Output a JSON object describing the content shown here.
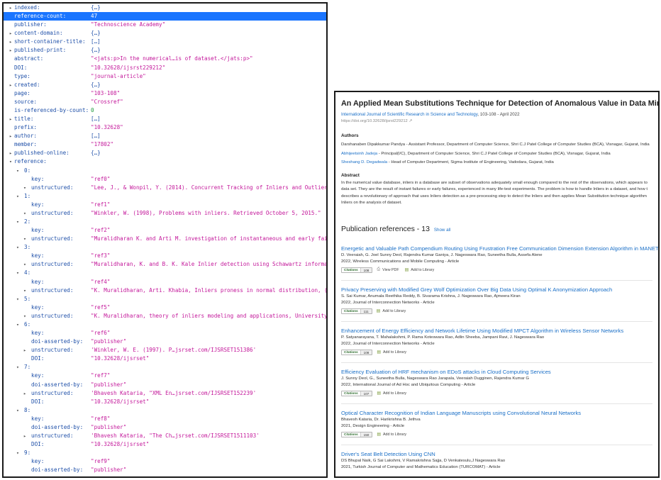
{
  "json_viewer": {
    "rows": [
      {
        "indent": 0,
        "toggle": "▸",
        "key": "indexed:",
        "value": "{…}",
        "vtype": "obj"
      },
      {
        "indent": 0,
        "toggle": "",
        "key": "reference-count:",
        "value": "47",
        "vtype": "num",
        "selected": true
      },
      {
        "indent": 0,
        "toggle": "",
        "key": "publisher:",
        "value": "\"Technoscience Academy\"",
        "vtype": "str"
      },
      {
        "indent": 0,
        "toggle": "▸",
        "key": "content-domain:",
        "value": "{…}",
        "vtype": "obj"
      },
      {
        "indent": 0,
        "toggle": "▸",
        "key": "short-container-title:",
        "value": "[…]",
        "vtype": "obj"
      },
      {
        "indent": 0,
        "toggle": "▸",
        "key": "published-print:",
        "value": "{…}",
        "vtype": "obj"
      },
      {
        "indent": 0,
        "toggle": "",
        "key": "abstract:",
        "value": "\"<jats:p>In the numerical…is of dataset.</jats:p>\"",
        "vtype": "str"
      },
      {
        "indent": 0,
        "toggle": "",
        "key": "DOI:",
        "value": "\"10.32628/ijsrst229212\"",
        "vtype": "str"
      },
      {
        "indent": 0,
        "toggle": "",
        "key": "type:",
        "value": "\"journal-article\"",
        "vtype": "str"
      },
      {
        "indent": 0,
        "toggle": "▸",
        "key": "created:",
        "value": "{…}",
        "vtype": "obj"
      },
      {
        "indent": 0,
        "toggle": "",
        "key": "page:",
        "value": "\"103-108\"",
        "vtype": "str"
      },
      {
        "indent": 0,
        "toggle": "",
        "key": "source:",
        "value": "\"Crossref\"",
        "vtype": "str"
      },
      {
        "indent": 0,
        "toggle": "",
        "key": "is-referenced-by-count:",
        "value": "0",
        "vtype": "num"
      },
      {
        "indent": 0,
        "toggle": "▸",
        "key": "title:",
        "value": "[…]",
        "vtype": "obj"
      },
      {
        "indent": 0,
        "toggle": "",
        "key": "prefix:",
        "value": "\"10.32628\"",
        "vtype": "str"
      },
      {
        "indent": 0,
        "toggle": "▸",
        "key": "author:",
        "value": "[…]",
        "vtype": "obj"
      },
      {
        "indent": 0,
        "toggle": "",
        "key": "member:",
        "value": "\"17802\"",
        "vtype": "str"
      },
      {
        "indent": 0,
        "toggle": "▸",
        "key": "published-online:",
        "value": "{…}",
        "vtype": "obj"
      },
      {
        "indent": 0,
        "toggle": "▾",
        "key": "reference:",
        "value": "",
        "vtype": "obj"
      },
      {
        "indent": 1,
        "toggle": "▾",
        "key": "0:",
        "value": "",
        "vtype": "obj"
      },
      {
        "indent": 2,
        "toggle": "",
        "key": "key:",
        "value": "\"ref0\"",
        "vtype": "str"
      },
      {
        "indent": 2,
        "toggle": "▾",
        "key": "unstructured:",
        "value": "\"Lee, J., & Wonpil, Y. (2014). Concurrent Tracking of Inliers and Outliers.\"",
        "vtype": "str"
      },
      {
        "indent": 1,
        "toggle": "▾",
        "key": "1:",
        "value": "",
        "vtype": "obj"
      },
      {
        "indent": 2,
        "toggle": "",
        "key": "key:",
        "value": "\"ref1\"",
        "vtype": "str"
      },
      {
        "indent": 2,
        "toggle": "▾",
        "key": "unstructured:",
        "value": "\"Winkler, W. (1998), Problems with inliers. Retrieved October 5, 2015.\"",
        "vtype": "str"
      },
      {
        "indent": 1,
        "toggle": "▾",
        "key": "2:",
        "value": "",
        "vtype": "obj"
      },
      {
        "indent": 2,
        "toggle": "",
        "key": "key:",
        "value": "\"ref2\"",
        "vtype": "str"
      },
      {
        "indent": 2,
        "toggle": "▾",
        "key": "unstructured:",
        "value": "\"Muralidharan K. and Arti M. investigation of instantaneous and early failures in I",
        "vtype": "str"
      },
      {
        "indent": 1,
        "toggle": "▾",
        "key": "3:",
        "value": "",
        "vtype": "obj"
      },
      {
        "indent": 2,
        "toggle": "",
        "key": "key:",
        "value": "\"ref3\"",
        "vtype": "str"
      },
      {
        "indent": 2,
        "toggle": "▾",
        "key": "unstructured:",
        "value": "\"Muralidharan, K. and B. K. Kale Inlier detection using Schawartz information crit",
        "vtype": "str"
      },
      {
        "indent": 1,
        "toggle": "▾",
        "key": "4:",
        "value": "",
        "vtype": "obj"
      },
      {
        "indent": 2,
        "toggle": "",
        "key": "key:",
        "value": "\"ref4\"",
        "vtype": "str"
      },
      {
        "indent": 2,
        "toggle": "▾",
        "key": "unstructured:",
        "value": "\"K. Muralidharan, Arti. Khabia, Inliers proness in normal distribution, (Vol.8) 20",
        "vtype": "str"
      },
      {
        "indent": 1,
        "toggle": "▾",
        "key": "5:",
        "value": "",
        "vtype": "obj"
      },
      {
        "indent": 2,
        "toggle": "",
        "key": "key:",
        "value": "\"ref5\"",
        "vtype": "str"
      },
      {
        "indent": 2,
        "toggle": "▾",
        "key": "unstructured:",
        "value": "\"K. Muralidharan, theory of inliers modeling and applications, University of Bedfo",
        "vtype": "str"
      },
      {
        "indent": 1,
        "toggle": "▾",
        "key": "6:",
        "value": "",
        "vtype": "obj"
      },
      {
        "indent": 2,
        "toggle": "",
        "key": "key:",
        "value": "\"ref6\"",
        "vtype": "str"
      },
      {
        "indent": 2,
        "toggle": "",
        "key": "doi-asserted-by:",
        "value": "\"publisher\"",
        "vtype": "str"
      },
      {
        "indent": 2,
        "toggle": "▸",
        "key": "unstructured:",
        "value": "'Winkler, W. E. (1997). P…jsrset.com/IJSRSET151386'",
        "vtype": "str"
      },
      {
        "indent": 2,
        "toggle": "",
        "key": "DOI:",
        "value": "\"10.32628/ijsrset\"",
        "vtype": "str"
      },
      {
        "indent": 1,
        "toggle": "▾",
        "key": "7:",
        "value": "",
        "vtype": "obj"
      },
      {
        "indent": 2,
        "toggle": "",
        "key": "key:",
        "value": "\"ref7\"",
        "vtype": "str"
      },
      {
        "indent": 2,
        "toggle": "",
        "key": "doi-asserted-by:",
        "value": "\"publisher\"",
        "vtype": "str"
      },
      {
        "indent": 2,
        "toggle": "▸",
        "key": "unstructured:",
        "value": "'Bhavesh Kataria, \"XML En…jsrset.com/IJSRSET152239'",
        "vtype": "str"
      },
      {
        "indent": 2,
        "toggle": "",
        "key": "DOI:",
        "value": "\"10.32628/ijsrset\"",
        "vtype": "str"
      },
      {
        "indent": 1,
        "toggle": "▾",
        "key": "8:",
        "value": "",
        "vtype": "obj"
      },
      {
        "indent": 2,
        "toggle": "",
        "key": "key:",
        "value": "\"ref8\"",
        "vtype": "str"
      },
      {
        "indent": 2,
        "toggle": "",
        "key": "doi-asserted-by:",
        "value": "\"publisher\"",
        "vtype": "str"
      },
      {
        "indent": 2,
        "toggle": "▸",
        "key": "unstructured:",
        "value": "'Bhavesh Kataria, \"The Ch…jsrset.com/IJSRSET1511103'",
        "vtype": "str"
      },
      {
        "indent": 2,
        "toggle": "",
        "key": "DOI:",
        "value": "\"10.32628/ijsrset\"",
        "vtype": "str"
      },
      {
        "indent": 1,
        "toggle": "▾",
        "key": "9:",
        "value": "",
        "vtype": "obj"
      },
      {
        "indent": 2,
        "toggle": "",
        "key": "key:",
        "value": "\"ref9\"",
        "vtype": "str"
      },
      {
        "indent": 2,
        "toggle": "",
        "key": "doi-asserted-by:",
        "value": "\"publisher\"",
        "vtype": "str"
      }
    ]
  },
  "paper": {
    "title": "An Applied Mean Substitutions Technique for Detection of Anomalous Value in Data Mining",
    "journal": "International Journal of Scientific Research in Science and Technology",
    "meta_rest": ", 103-108 - April 2022",
    "doi": "https://doi.org/10.32628/ijsrst229212 ↗",
    "authors_heading": "Authors",
    "authors": [
      {
        "name": "Darshanaben Dipakkumar Pandya",
        "rest": " - Assistant Professor, Department of Computer Science, Shri C.J Patel College of Computer Studies (BCA), Visnagar, Gujarat, India",
        "linked": false
      },
      {
        "name": "Abhijeetsinh Jadeja",
        "rest": " - Principal(I/C), Department of Computer Science, Shri C.J Patel College of Computer Studies (BCA), Visnagar, Gujarat, India",
        "linked": true
      },
      {
        "name": "Sheshang D. Degadwala",
        "rest": " - Head of Computer Department, Sigma Institute of Engineering, Vadodara, Gujarat, India",
        "linked": true
      }
    ],
    "abstract_heading": "Abstract",
    "abstract_lines": [
      "In the numerical value database, inliers in a database are subset of observations adequately small enough compared to the rest of the observations, which appears to",
      "data set. They are the result of instant failures or early failures, experienced in many life-test experiments. The problem is how to handle Inliers in a dataset, and how t",
      "describes a revolutionary of approach that uses Inliers detection as a pre-processing step to detect the Inliers and then applies Mean Substitution technique algorithm",
      "Inliers on the analysis of dataset."
    ]
  },
  "refs": {
    "heading": "Publication references - 13",
    "show_all": "Show all",
    "badge_label": "Citations",
    "view_pdf": "View PDF",
    "add_library": "Add to Library",
    "items": [
      {
        "title": "Energetic and Valuable Path Compendium Routing Using Frustration Free Communication Dimension Extension Algorithm in MANET",
        "authors": "D. Veeraiah, G. Joel Sunny Deol, Rajendra Kumar Ganiya, J. Nageswara Rao, Suneetha Bulla, Assefa Alene",
        "venue": "2022, Wireless Communications and Mobile Computing - Article",
        "count": "108",
        "pdf": true
      },
      {
        "title": "Privacy Preserving with Modified Grey Wolf Optimization Over Big Data Using Optimal K Anonymization Approach",
        "authors": "S. Sai Kumar, Anumala Reethika Reddy, B. Sivarama Krishna, J. Nageswara Rao, Ajmeera Kiran",
        "venue": "2022, Journal of Interconnection Networks - Article",
        "count": "111",
        "pdf": false
      },
      {
        "title": "Enhancement of Energy Efficiency and Network Lifetime Using Modified MPCT Algorithm in Wireless Sensor Networks",
        "authors": "P. Satyanarayana, T. Mahalakshmi, P. Rama Koteswara Rao, Adlin Sheeba, Jampani Ravi, J. Nageswara Rao",
        "venue": "2022, Journal of Interconnection Networks - Article",
        "count": "108",
        "pdf": false
      },
      {
        "title": "Efficiency Evaluation of HRF mechanism on EDoS attacks in Cloud Computing Services",
        "authors": "J. Sunny Deol, G., Suneetha Bulla, Nageswara Rao Jarapala, Veeraiah Dugginen, Rajendra Kumar G",
        "venue": "2022, International Journal of Ad Hoc and Ubiquitous Computing - Article",
        "count": "107",
        "pdf": false
      },
      {
        "title": "Optical Character Recognition of Indian Language Manuscripts using Convolutional Neural Networks",
        "authors": "Bhavesh Kataria, Dr. Harikrishna B. Jethva",
        "venue": "2021, Design Engineering - Article",
        "count": "150",
        "pdf": false
      },
      {
        "title": "Driver's Seat Belt Detection Using CNN",
        "authors": "DS Bhupal Naik, G Sai Lakshmi, V Ramakrishna Sajja, D Venkatesulu,J Nageswara Rao",
        "venue": "2021, Turkish Journal of Computer and Mathematics Education (TURCOMAT) - Article",
        "count": "",
        "pdf": false
      }
    ]
  }
}
